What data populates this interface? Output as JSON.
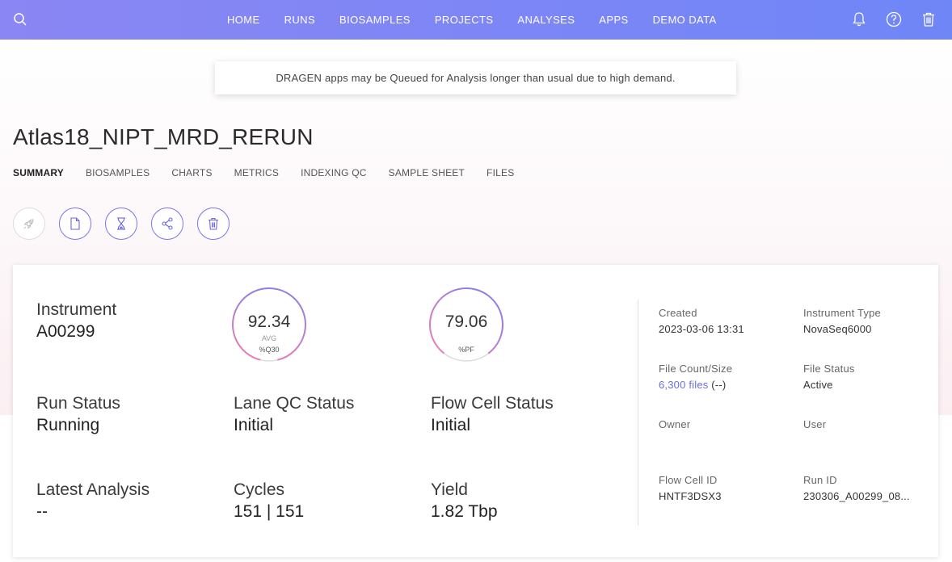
{
  "nav": {
    "items": [
      "HOME",
      "RUNS",
      "BIOSAMPLES",
      "PROJECTS",
      "ANALYSES",
      "APPS",
      "DEMO DATA"
    ],
    "icons": [
      "bell-icon",
      "help-icon",
      "trash-icon"
    ]
  },
  "banner": {
    "text": "DRAGEN apps may be Queued for Analysis longer than usual due to high demand."
  },
  "page": {
    "title": "Atlas18_NIPT_MRD_RERUN"
  },
  "tabs": [
    "SUMMARY",
    "BIOSAMPLES",
    "CHARTS",
    "METRICS",
    "INDEXING QC",
    "SAMPLE SHEET",
    "FILES"
  ],
  "summary": {
    "instrument": {
      "label": "Instrument",
      "value": "A00299"
    },
    "q30": {
      "value": "92.34",
      "sub": "AVG",
      "caption": "%Q30",
      "fraction": 0.9234
    },
    "pf": {
      "value": "79.06",
      "caption": "%PF",
      "fraction": 0.7906
    },
    "run_status": {
      "label": "Run Status",
      "value": "Running"
    },
    "lane_qc": {
      "label": "Lane QC Status",
      "value": "Initial"
    },
    "flow_cell_status": {
      "label": "Flow Cell Status",
      "value": "Initial"
    },
    "latest_analysis": {
      "label": "Latest Analysis",
      "value": "--"
    },
    "cycles": {
      "label": "Cycles",
      "value": "151 | 151"
    },
    "yield": {
      "label": "Yield",
      "value": "1.82 Tbp"
    }
  },
  "details": {
    "created": {
      "label": "Created",
      "value": "2023-03-06 13:31"
    },
    "instrument_type": {
      "label": "Instrument Type",
      "value": "NovaSeq6000"
    },
    "file_count": {
      "label": "File Count/Size",
      "link": "6,300 files",
      "suffix": " (--)"
    },
    "file_status": {
      "label": "File Status",
      "value": "Active"
    },
    "owner": {
      "label": "Owner",
      "value": ""
    },
    "user": {
      "label": "User",
      "value": ""
    },
    "flow_cell_id": {
      "label": "Flow Cell ID",
      "value": "HNTF3DSX3"
    },
    "run_id": {
      "label": "Run ID",
      "value": "230306_A00299_08..."
    }
  },
  "colors": {
    "nav_start": "#8a86f3",
    "nav_end": "#6f86f7",
    "accent": "#7b73e8",
    "gauge_pink": "#e77bb8",
    "link": "#6a6ee0"
  }
}
